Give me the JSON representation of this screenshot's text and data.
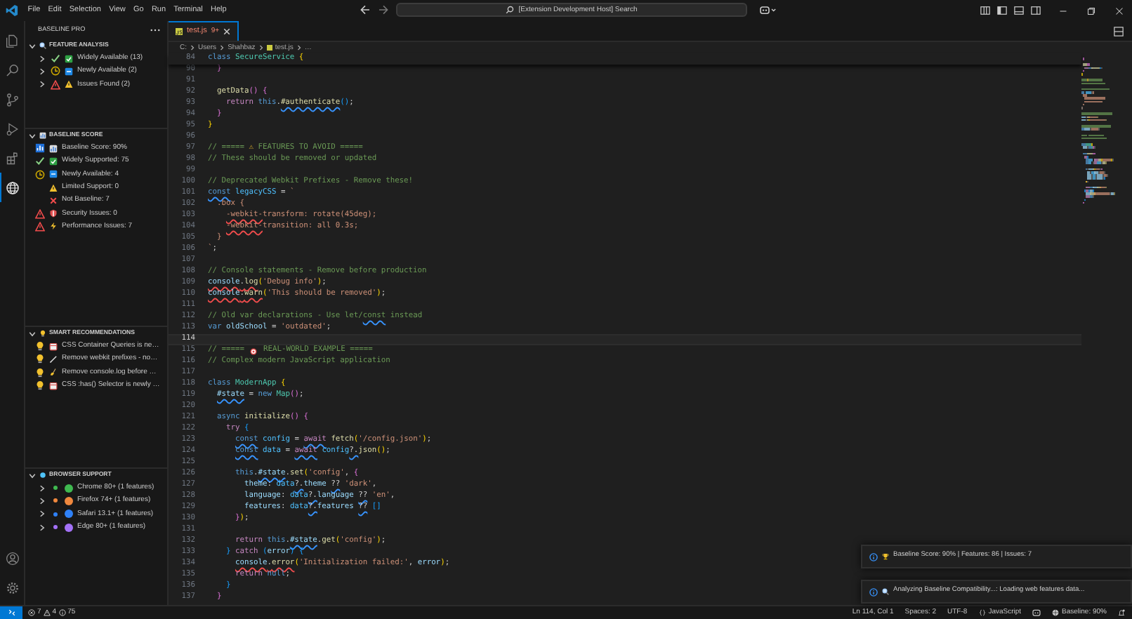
{
  "title_bar": {
    "menu": [
      "File",
      "Edit",
      "Selection",
      "View",
      "Go",
      "Run",
      "Terminal",
      "Help"
    ],
    "search": "[Extension Development Host] Search"
  },
  "sidebar": {
    "title": "BASELINE PRO",
    "sections": [
      {
        "title": "FEATURE ANALYSIS",
        "kind": "search",
        "expanded": true,
        "items": [
          {
            "label": "Widely Available (13)",
            "kind": "available",
            "expanded": false
          },
          {
            "label": "Newly Available (2)",
            "kind": "newly",
            "expanded": false
          },
          {
            "label": "Issues Found (2)",
            "kind": "issues",
            "expanded": false
          }
        ]
      },
      {
        "title": "BASELINE SCORE",
        "kind": "chart",
        "expanded": true,
        "items": [
          {
            "label": "Baseline Score: 90%",
            "kind": "score"
          },
          {
            "label": "Widely Supported: 75",
            "kind": "widely"
          },
          {
            "label": "Newly Available: 4",
            "kind": "newly"
          },
          {
            "label": "Limited Support: 0",
            "kind": "limited"
          },
          {
            "label": "Not Baseline: 7",
            "kind": "not"
          },
          {
            "label": "Security Issues: 0",
            "kind": "security"
          },
          {
            "label": "Performance Issues: 7",
            "kind": "performance"
          }
        ]
      },
      {
        "title": "SMART RECOMMENDATIONS",
        "kind": "bulb",
        "expanded": true,
        "items": [
          {
            "label": "CSS Container Queries is ne…",
            "kind": "container"
          },
          {
            "label": "Remove webkit prefixes - no…",
            "kind": "webkit"
          },
          {
            "label": "Remove console.log before …",
            "kind": "console"
          },
          {
            "label": "CSS :has() Selector is newly …",
            "kind": "container"
          }
        ]
      },
      {
        "title": "BROWSER SUPPORT",
        "kind": "dot",
        "expanded": true,
        "items": [
          {
            "label": "Chrome 80+ (1 features)",
            "color": "#3fb950",
            "expanded": false
          },
          {
            "label": "Firefox 74+ (1 features)",
            "color": "#f0883e",
            "expanded": false
          },
          {
            "label": "Safari 13.1+ (1 features)",
            "color": "#2f81f7",
            "expanded": false
          },
          {
            "label": "Edge 80+ (1 features)",
            "color": "#a371f7",
            "expanded": false
          }
        ]
      }
    ]
  },
  "editor": {
    "tab": {
      "label": "test.js",
      "badge": "9+",
      "selected": true
    },
    "breadcrumb": [
      "C:",
      "Users",
      "Shahbaz",
      "test.js",
      "…"
    ],
    "sticky": {
      "number": "84",
      "tokens": [
        {
          "kind": "kw",
          "text": "class "
        },
        {
          "kind": "cls",
          "text": "SecureService "
        },
        {
          "kind": "b1",
          "text": "{"
        }
      ]
    },
    "lines": [
      {
        "number": "90",
        "current": false,
        "tokens": [
          {
            "kind": "b2",
            "text": "  }"
          }
        ]
      },
      {
        "number": "91",
        "current": false
      },
      {
        "number": "92",
        "current": false,
        "tokens": [
          {
            "kind": "fn",
            "text": "  getData"
          },
          {
            "kind": "b2",
            "text": "() {"
          }
        ]
      },
      {
        "number": "93",
        "current": false,
        "tokens": [
          {
            "kind": "ctl",
            "text": "    return "
          },
          {
            "kind": "kw",
            "text": "this"
          },
          {
            "kind": "p",
            "text": "."
          },
          {
            "kind": "fn",
            "text": "#authenticate",
            "hint": true
          },
          {
            "kind": "b3",
            "text": "()"
          },
          {
            "kind": "p",
            "text": ";"
          }
        ]
      },
      {
        "number": "94",
        "current": false,
        "tokens": [
          {
            "kind": "b2",
            "text": "  }"
          }
        ]
      },
      {
        "number": "95",
        "current": false,
        "tokens": [
          {
            "kind": "b1",
            "text": "}"
          }
        ]
      },
      {
        "number": "96",
        "current": false
      },
      {
        "number": "97",
        "current": false,
        "tokens": [
          {
            "kind": "cmt",
            "text": "// ===== "
          },
          {
            "kind": "emo",
            "text": "⚠"
          },
          {
            "kind": "cmt",
            "text": " FEATURES TO AVOID ====="
          }
        ]
      },
      {
        "number": "98",
        "current": false,
        "tokens": [
          {
            "kind": "cmt",
            "text": "// These should be removed or updated"
          }
        ]
      },
      {
        "number": "99",
        "current": false
      },
      {
        "number": "100",
        "current": false,
        "tokens": [
          {
            "kind": "cmt",
            "text": "// Deprecated Webkit Prefixes - Remove these!"
          }
        ]
      },
      {
        "number": "101",
        "current": false,
        "tokens": [
          {
            "kind": "kw",
            "text": "const",
            "hint": true
          },
          {
            "kind": "cst",
            "text": " legacyCSS"
          },
          {
            "kind": "p",
            "text": " = "
          },
          {
            "kind": "str",
            "text": "`"
          }
        ]
      },
      {
        "number": "102",
        "current": false,
        "tokens": [
          {
            "kind": "str",
            "text": "  .box {"
          }
        ]
      },
      {
        "number": "103",
        "current": false,
        "tokens": [
          {
            "kind": "str",
            "text": "    -webkit-",
            "error": true
          },
          {
            "kind": "str",
            "text": "transform: rotate(45deg);"
          }
        ]
      },
      {
        "number": "104",
        "current": false,
        "tokens": [
          {
            "kind": "str",
            "text": "    -webkit-",
            "error": true
          },
          {
            "kind": "str",
            "text": "transition: all 0.3s;"
          }
        ]
      },
      {
        "number": "105",
        "current": false,
        "tokens": [
          {
            "kind": "str",
            "text": "  }"
          }
        ]
      },
      {
        "number": "106",
        "current": false,
        "tokens": [
          {
            "kind": "str",
            "text": "`"
          },
          {
            "kind": "p",
            "text": ";"
          }
        ]
      },
      {
        "number": "107",
        "current": false
      },
      {
        "number": "108",
        "current": false,
        "tokens": [
          {
            "kind": "cmt",
            "text": "// Console statements - Remove before production"
          }
        ]
      },
      {
        "number": "109",
        "current": false,
        "tokens": [
          {
            "kind": "var",
            "text": "console",
            "error": true
          },
          {
            "kind": "p",
            "text": ".",
            "error": true
          },
          {
            "kind": "fn",
            "text": "log",
            "error": true
          },
          {
            "kind": "b1",
            "text": "("
          },
          {
            "kind": "str",
            "text": "'Debug info'"
          },
          {
            "kind": "b1",
            "text": ")"
          },
          {
            "kind": "p",
            "text": ";"
          }
        ]
      },
      {
        "number": "110",
        "current": false,
        "tokens": [
          {
            "kind": "var",
            "text": "console",
            "error": true
          },
          {
            "kind": "p",
            "text": ".",
            "error": true
          },
          {
            "kind": "fn",
            "text": "warn",
            "error": true
          },
          {
            "kind": "b1",
            "text": "("
          },
          {
            "kind": "str",
            "text": "'This should be removed'"
          },
          {
            "kind": "b1",
            "text": ")"
          },
          {
            "kind": "p",
            "text": ";"
          }
        ]
      },
      {
        "number": "111",
        "current": false
      },
      {
        "number": "112",
        "current": false,
        "tokens": [
          {
            "kind": "cmt",
            "text": "// Old var declarations - Use let/"
          },
          {
            "kind": "cmt",
            "text": "const",
            "hint": true
          },
          {
            "kind": "cmt",
            "text": " instead"
          }
        ]
      },
      {
        "number": "113",
        "current": false,
        "tokens": [
          {
            "kind": "kw",
            "text": "var "
          },
          {
            "kind": "var",
            "text": "oldSchool"
          },
          {
            "kind": "p",
            "text": " = "
          },
          {
            "kind": "str",
            "text": "'outdated'"
          },
          {
            "kind": "p",
            "text": ";"
          }
        ]
      },
      {
        "number": "114",
        "current": true
      },
      {
        "number": "115",
        "current": false,
        "tokens": [
          {
            "kind": "cmt",
            "text": "// ===== "
          },
          {
            "kind": "target"
          },
          {
            "kind": "cmt",
            "text": " REAL-WORLD EXAMPLE ====="
          }
        ]
      },
      {
        "number": "116",
        "current": false,
        "tokens": [
          {
            "kind": "cmt",
            "text": "// Complex modern JavaScript application"
          }
        ]
      },
      {
        "number": "117",
        "current": false
      },
      {
        "number": "118",
        "current": false,
        "tokens": [
          {
            "kind": "kw",
            "text": "class "
          },
          {
            "kind": "cls",
            "text": "ModernApp "
          },
          {
            "kind": "b1",
            "text": "{"
          }
        ]
      },
      {
        "number": "119",
        "current": false,
        "tokens": [
          {
            "kind": "var",
            "text": "  #state",
            "hint": true
          },
          {
            "kind": "p",
            "text": " = "
          },
          {
            "kind": "kw",
            "text": "new "
          },
          {
            "kind": "cls",
            "text": "Map"
          },
          {
            "kind": "b2",
            "text": "()"
          },
          {
            "kind": "p",
            "text": ";"
          }
        ]
      },
      {
        "number": "120",
        "current": false
      },
      {
        "number": "121",
        "current": false,
        "tokens": [
          {
            "kind": "kw",
            "text": "  async "
          },
          {
            "kind": "fn",
            "text": "initialize"
          },
          {
            "kind": "b2",
            "text": "() {"
          }
        ]
      },
      {
        "number": "122",
        "current": false,
        "tokens": [
          {
            "kind": "ctl",
            "text": "    try "
          },
          {
            "kind": "b3",
            "text": "{"
          }
        ]
      },
      {
        "number": "123",
        "current": false,
        "tokens": [
          {
            "kind": "kw",
            "text": "      const",
            "hint": true
          },
          {
            "kind": "cst",
            "text": " config"
          },
          {
            "kind": "p",
            "text": " = "
          },
          {
            "kind": "ctl",
            "text": "await",
            "hint": true
          },
          {
            "kind": "fn",
            "text": " fetch"
          },
          {
            "kind": "b1",
            "text": "("
          },
          {
            "kind": "str",
            "text": "'/config.json'"
          },
          {
            "kind": "b1",
            "text": ")"
          },
          {
            "kind": "p",
            "text": ";"
          }
        ]
      },
      {
        "number": "124",
        "current": false,
        "tokens": [
          {
            "kind": "kw",
            "text": "      const",
            "hint": true
          },
          {
            "kind": "cst",
            "text": " data"
          },
          {
            "kind": "p",
            "text": " = "
          },
          {
            "kind": "ctl",
            "text": "await",
            "hint": true
          },
          {
            "kind": "cst",
            "text": " config"
          },
          {
            "kind": "p",
            "text": "?.",
            "hint": true
          },
          {
            "kind": "fn",
            "text": "json"
          },
          {
            "kind": "b1",
            "text": "()"
          },
          {
            "kind": "p",
            "text": ";"
          }
        ]
      },
      {
        "number": "125",
        "current": false
      },
      {
        "number": "126",
        "current": false,
        "tokens": [
          {
            "kind": "kw",
            "text": "      this"
          },
          {
            "kind": "p",
            "text": "."
          },
          {
            "kind": "var",
            "text": "#state",
            "hint": true
          },
          {
            "kind": "p",
            "text": "."
          },
          {
            "kind": "fn",
            "text": "set"
          },
          {
            "kind": "b1",
            "text": "("
          },
          {
            "kind": "str",
            "text": "'config'"
          },
          {
            "kind": "p",
            "text": ", "
          },
          {
            "kind": "b2",
            "text": "{"
          }
        ]
      },
      {
        "number": "127",
        "current": false,
        "tokens": [
          {
            "kind": "var",
            "text": "        theme"
          },
          {
            "kind": "p",
            "text": ": "
          },
          {
            "kind": "cst",
            "text": "data"
          },
          {
            "kind": "p",
            "text": "?.",
            "hint": true
          },
          {
            "kind": "var",
            "text": "theme "
          },
          {
            "kind": "p",
            "text": "??",
            "hint": true
          },
          {
            "kind": "str",
            "text": " 'dark'"
          },
          {
            "kind": "p",
            "text": ","
          }
        ]
      },
      {
        "number": "128",
        "current": false,
        "tokens": [
          {
            "kind": "var",
            "text": "        language"
          },
          {
            "kind": "p",
            "text": ": "
          },
          {
            "kind": "cst",
            "text": "data"
          },
          {
            "kind": "p",
            "text": "?.",
            "hint": true
          },
          {
            "kind": "var",
            "text": "language "
          },
          {
            "kind": "p",
            "text": "??",
            "hint": true
          },
          {
            "kind": "str",
            "text": " 'en'"
          },
          {
            "kind": "p",
            "text": ","
          }
        ]
      },
      {
        "number": "129",
        "current": false,
        "tokens": [
          {
            "kind": "var",
            "text": "        features"
          },
          {
            "kind": "p",
            "text": ": "
          },
          {
            "kind": "cst",
            "text": "data"
          },
          {
            "kind": "p",
            "text": "?.",
            "hint": true
          },
          {
            "kind": "var",
            "text": "features "
          },
          {
            "kind": "p",
            "text": "??",
            "hint": true
          },
          {
            "kind": "b3",
            "text": " []"
          }
        ]
      },
      {
        "number": "130",
        "current": false,
        "tokens": [
          {
            "kind": "b2",
            "text": "      }"
          },
          {
            "kind": "b1",
            "text": ")"
          },
          {
            "kind": "p",
            "text": ";"
          }
        ]
      },
      {
        "number": "131",
        "current": false
      },
      {
        "number": "132",
        "current": false,
        "tokens": [
          {
            "kind": "ctl",
            "text": "      return "
          },
          {
            "kind": "kw",
            "text": "this"
          },
          {
            "kind": "p",
            "text": "."
          },
          {
            "kind": "var",
            "text": "#state",
            "hint": true
          },
          {
            "kind": "p",
            "text": "."
          },
          {
            "kind": "fn",
            "text": "get"
          },
          {
            "kind": "b1",
            "text": "("
          },
          {
            "kind": "str",
            "text": "'config'"
          },
          {
            "kind": "b1",
            "text": ")"
          },
          {
            "kind": "p",
            "text": ";"
          }
        ]
      },
      {
        "number": "133",
        "current": false,
        "tokens": [
          {
            "kind": "b3",
            "text": "    }"
          },
          {
            "kind": "ctl",
            "text": " catch "
          },
          {
            "kind": "b3",
            "text": "("
          },
          {
            "kind": "var",
            "text": "error"
          },
          {
            "kind": "b3",
            "text": ") {"
          }
        ]
      },
      {
        "number": "134",
        "current": false,
        "tokens": [
          {
            "kind": "var",
            "text": "      console",
            "error": true
          },
          {
            "kind": "p",
            "text": ".",
            "error": true
          },
          {
            "kind": "fn",
            "text": "error",
            "error": true
          },
          {
            "kind": "b1",
            "text": "("
          },
          {
            "kind": "str",
            "text": "'Initialization failed:'"
          },
          {
            "kind": "p",
            "text": ", "
          },
          {
            "kind": "var",
            "text": "error"
          },
          {
            "kind": "b1",
            "text": ")"
          },
          {
            "kind": "p",
            "text": ";"
          }
        ]
      },
      {
        "number": "135",
        "current": false,
        "tokens": [
          {
            "kind": "ctl",
            "text": "      return "
          },
          {
            "kind": "kw",
            "text": "null"
          },
          {
            "kind": "p",
            "text": ";"
          }
        ]
      },
      {
        "number": "136",
        "current": false,
        "tokens": [
          {
            "kind": "b3",
            "text": "    }"
          }
        ]
      },
      {
        "number": "137",
        "current": false,
        "tokens": [
          {
            "kind": "b2",
            "text": "  }"
          }
        ]
      }
    ],
    "notifications": [
      {
        "text": "Baseline Score: 90% | Features: 86 | Issues: 7",
        "kind": "trophy"
      },
      {
        "text": "Analyzing Baseline Compatibility...: Loading web features data...",
        "kind": "search"
      }
    ]
  },
  "status_bar": {
    "problems": [
      {
        "kind": "error",
        "count": "7"
      },
      {
        "kind": "warning",
        "count": "4"
      },
      {
        "kind": "info",
        "count": "75"
      }
    ],
    "right": [
      {
        "text": "Ln 114, Col 1",
        "kind": "plain"
      },
      {
        "text": "Spaces: 2",
        "kind": "plain"
      },
      {
        "text": "UTF-8",
        "kind": "plain"
      },
      {
        "text": "JavaScript",
        "kind": "language"
      },
      {
        "kind": "copilot"
      },
      {
        "text": "Baseline: 90%",
        "kind": "baseline"
      },
      {
        "kind": "bell"
      }
    ]
  }
}
